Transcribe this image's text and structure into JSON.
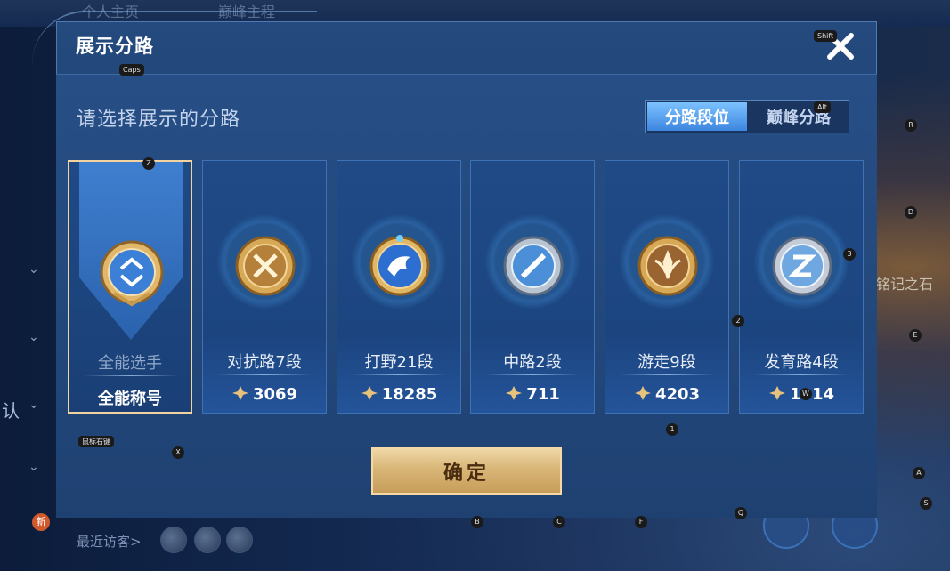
{
  "background": {
    "top_left_text": "个人主页",
    "top_mid_text": "巅峰主程",
    "left_partial_text": "认",
    "right_partial_text": "铭记之石",
    "new_badge": "新",
    "recent_visitors": "最近访客>"
  },
  "dialog": {
    "title": "展示分路",
    "subtitle": "请选择展示的分路",
    "tabs": [
      {
        "label": "分路段位",
        "active": true
      },
      {
        "label": "巅峰分路",
        "active": false
      }
    ],
    "cards": [
      {
        "name": "全能选手",
        "sub": "全能称号",
        "selected": true,
        "emblem": "all-round-emblem"
      },
      {
        "name": "对抗路7段",
        "score": "3069",
        "selected": false,
        "emblem": "clash-lane-emblem"
      },
      {
        "name": "打野21段",
        "score": "18285",
        "selected": false,
        "emblem": "jungle-emblem"
      },
      {
        "name": "中路2段",
        "score": "711",
        "selected": false,
        "emblem": "mid-lane-emblem"
      },
      {
        "name": "游走9段",
        "score": "4203",
        "selected": false,
        "emblem": "roam-emblem"
      },
      {
        "name": "发育路4段",
        "score": "1914",
        "selected": false,
        "emblem": "farm-lane-emblem"
      }
    ],
    "confirm_label": "确定"
  },
  "key_hints": {
    "shift": "Shift",
    "caps": "Caps",
    "alt": "Alt",
    "r": "R",
    "d": "D",
    "z": "Z",
    "three": "3",
    "two": "2",
    "e": "E",
    "one": "1",
    "w": "W",
    "mouse_right": "鼠标右键",
    "x": "X",
    "a": "A",
    "b": "B",
    "c": "C",
    "f": "F",
    "q": "Q",
    "s": "S"
  },
  "colors": {
    "accent_gold": "#e9c98a",
    "tab_active": "#4a96ea",
    "dialog_bg": "#22477a"
  }
}
